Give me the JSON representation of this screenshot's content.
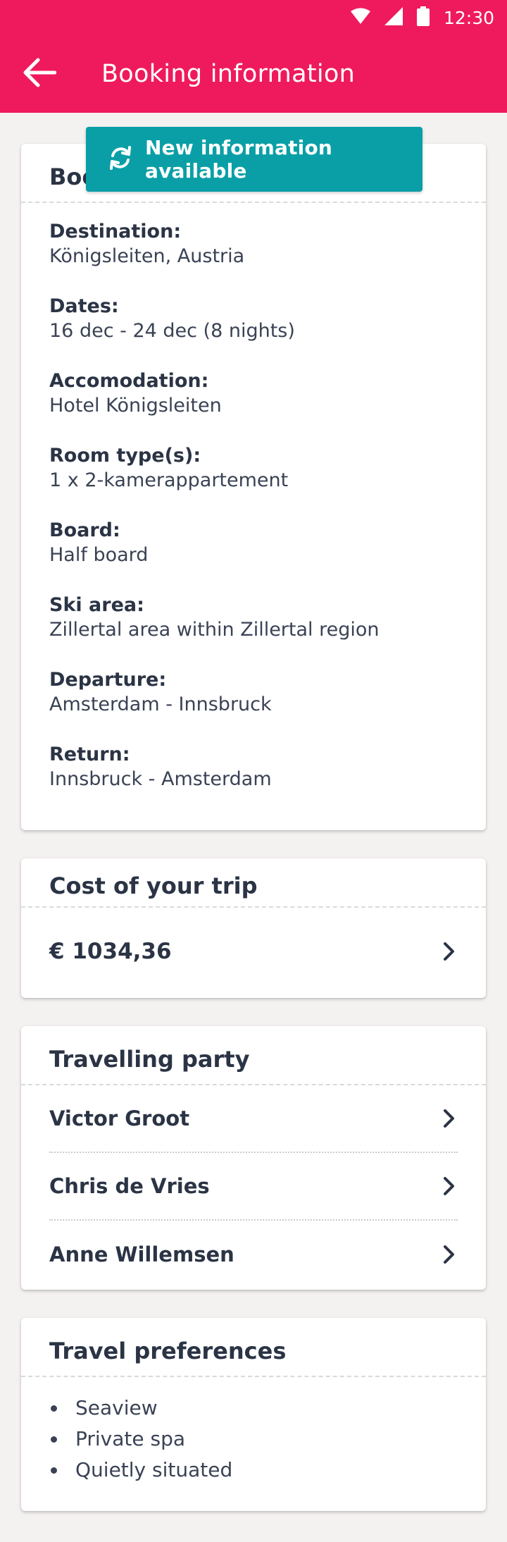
{
  "status_bar": {
    "time": "12:30"
  },
  "toolbar": {
    "title": "Booking information"
  },
  "toast": {
    "label": "New information available"
  },
  "booking": {
    "header": "Booking details",
    "fields": [
      {
        "label": "Destination:",
        "value": "Königsleiten, Austria"
      },
      {
        "label": "Dates:",
        "value": "16 dec - 24 dec (8 nights)"
      },
      {
        "label": "Accomodation:",
        "value": "Hotel Königsleiten"
      },
      {
        "label": "Room type(s):",
        "value": "1 x 2-kamerappartement"
      },
      {
        "label": "Board:",
        "value": "Half board"
      },
      {
        "label": "Ski area:",
        "value": "Zillertal area within Zillertal region"
      },
      {
        "label": "Departure:",
        "value": "Amsterdam - Innsbruck"
      },
      {
        "label": "Return:",
        "value": "Innsbruck - Amsterdam"
      }
    ]
  },
  "cost": {
    "header": "Cost of your trip",
    "amount": "€ 1034,36"
  },
  "party": {
    "header": "Travelling party",
    "members": [
      "Victor Groot",
      "Chris de Vries",
      "Anne Willemsen"
    ]
  },
  "preferences": {
    "header": "Travel preferences",
    "items": [
      "Seaview",
      "Private spa",
      "Quietly situated"
    ]
  },
  "colors": {
    "primary": "#ef1a5e",
    "accent": "#0a9fa6",
    "text": "#2b3445",
    "background": "#f4f1f1"
  },
  "icons": [
    "wifi-icon",
    "signal-icon",
    "battery-icon",
    "back-arrow-icon",
    "refresh-icon",
    "chevron-right-icon"
  ]
}
